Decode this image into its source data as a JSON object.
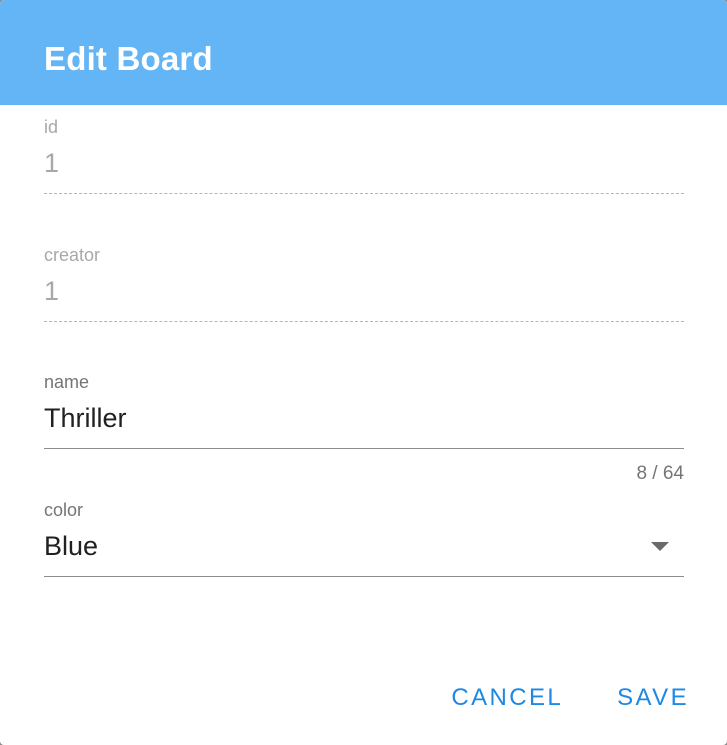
{
  "dialog": {
    "title": "Edit Board"
  },
  "fields": {
    "id": {
      "label": "id",
      "value": "1"
    },
    "creator": {
      "label": "creator",
      "value": "1"
    },
    "name": {
      "label": "name",
      "value": "Thriller",
      "counter": "8 / 64"
    },
    "color": {
      "label": "color",
      "value": "Blue"
    }
  },
  "actions": {
    "cancel_label": "CANCEL",
    "save_label": "SAVE"
  },
  "colors": {
    "header": "#64b5f6",
    "accent": "#1e88e5"
  },
  "icons": {
    "dropdown": "arrow-drop-down-icon"
  }
}
